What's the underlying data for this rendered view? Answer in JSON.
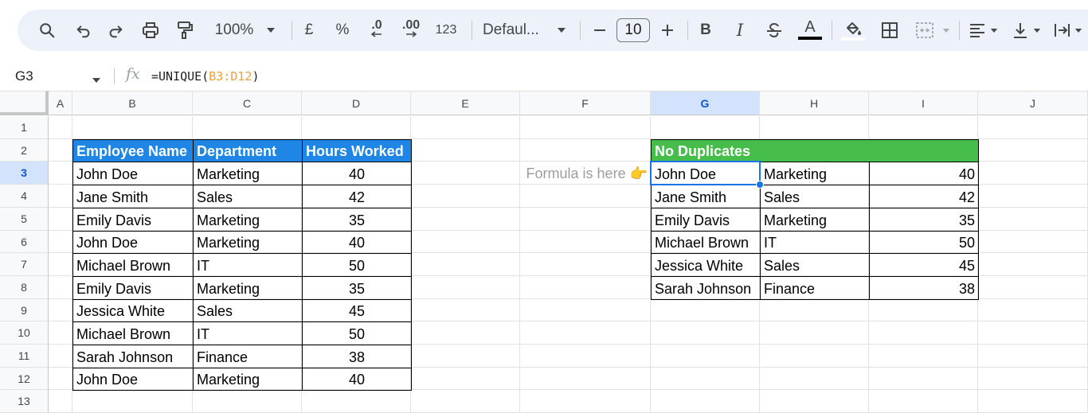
{
  "toolbar": {
    "zoom": "100%",
    "currency": "£",
    "percent": "%",
    "decrease_decimal": ".0",
    "increase_decimal": ".00",
    "number_format": "123",
    "font_name": "Defaul...",
    "font_size": "10",
    "bold": "B",
    "italic": "I",
    "text_color_letter": "A"
  },
  "formula_bar": {
    "name_box": "G3",
    "fx": "fx",
    "formula_prefix": "=UNIQUE(",
    "formula_range": "B3:D12",
    "formula_suffix": ")"
  },
  "columns": [
    "A",
    "B",
    "C",
    "D",
    "E",
    "F",
    "G",
    "H",
    "I",
    "J"
  ],
  "rows": [
    "1",
    "2",
    "3",
    "4",
    "5",
    "6",
    "7",
    "8",
    "9",
    "10",
    "11",
    "12",
    "13"
  ],
  "source_table": {
    "headers": [
      "Employee Name",
      "Department",
      "Hours Worked"
    ],
    "rows": [
      [
        "John Doe",
        "Marketing",
        "40"
      ],
      [
        "Jane Smith",
        "Sales",
        "42"
      ],
      [
        "Emily Davis",
        "Marketing",
        "35"
      ],
      [
        "John Doe",
        "Marketing",
        "40"
      ],
      [
        "Michael Brown",
        "IT",
        "50"
      ],
      [
        "Emily Davis",
        "Marketing",
        "35"
      ],
      [
        "Jessica White",
        "Sales",
        "45"
      ],
      [
        "Michael Brown",
        "IT",
        "50"
      ],
      [
        "Sarah Johnson",
        "Finance",
        "38"
      ],
      [
        "John Doe",
        "Marketing",
        "40"
      ]
    ]
  },
  "note": "Formula is here 👉",
  "result_table": {
    "header": "No Duplicates",
    "rows": [
      [
        "John Doe",
        "Marketing",
        "40"
      ],
      [
        "Jane Smith",
        "Sales",
        "42"
      ],
      [
        "Emily Davis",
        "Marketing",
        "35"
      ],
      [
        "Michael Brown",
        "IT",
        "50"
      ],
      [
        "Jessica White",
        "Sales",
        "45"
      ],
      [
        "Sarah Johnson",
        "Finance",
        "38"
      ]
    ]
  },
  "selected_cell": "G3",
  "colors": {
    "blue_header": "#1f86e6",
    "green_header": "#46bd4b",
    "selection": "#1a73e8",
    "range_highlight": "#e8a33c"
  }
}
